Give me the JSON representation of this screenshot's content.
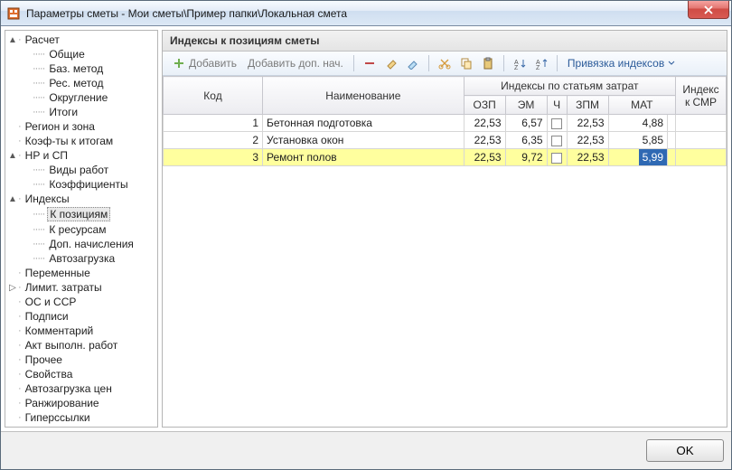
{
  "window": {
    "title": "Параметры сметы - Мои сметы\\Пример папки\\Локальная смета"
  },
  "tree": [
    {
      "arrow": "▲",
      "label": "Расчет"
    },
    {
      "indent": 1,
      "label": "Общие"
    },
    {
      "indent": 1,
      "label": "Баз. метод"
    },
    {
      "indent": 1,
      "label": "Рес. метод"
    },
    {
      "indent": 1,
      "label": "Округление"
    },
    {
      "indent": 1,
      "label": "Итоги"
    },
    {
      "arrow": "",
      "label": "Регион и зона"
    },
    {
      "arrow": "",
      "label": "Коэф-ты к итогам"
    },
    {
      "arrow": "▲",
      "label": "НР и СП"
    },
    {
      "indent": 1,
      "label": "Виды работ"
    },
    {
      "indent": 1,
      "label": "Коэффициенты"
    },
    {
      "arrow": "▲",
      "label": "Индексы"
    },
    {
      "indent": 1,
      "label": "К позициям",
      "selected": true
    },
    {
      "indent": 1,
      "label": "К ресурсам"
    },
    {
      "indent": 1,
      "label": "Доп. начисления"
    },
    {
      "indent": 1,
      "label": "Автозагрузка"
    },
    {
      "arrow": "",
      "label": "Переменные"
    },
    {
      "arrow": "▷",
      "label": "Лимит. затраты"
    },
    {
      "arrow": "",
      "label": "ОС и ССР"
    },
    {
      "arrow": "",
      "label": "Подписи"
    },
    {
      "arrow": "",
      "label": "Комментарий"
    },
    {
      "arrow": "",
      "label": "Акт выполн. работ"
    },
    {
      "arrow": "",
      "label": "Прочее"
    },
    {
      "arrow": "",
      "label": "Свойства"
    },
    {
      "arrow": "",
      "label": "Автозагрузка цен"
    },
    {
      "arrow": "",
      "label": "Ранжирование"
    },
    {
      "arrow": "",
      "label": "Гиперссылки"
    }
  ],
  "main": {
    "title": "Индексы к позициям сметы"
  },
  "toolbar": {
    "add": "Добавить",
    "add_extra": "Добавить доп. нач.",
    "bind": "Привязка индексов"
  },
  "grid": {
    "headers": {
      "code": "Код",
      "name": "Наименование",
      "group": "Индексы по статьям затрат",
      "ozp": "ОЗП",
      "em": "ЭМ",
      "ch": "Ч",
      "zpm": "ЗПМ",
      "mat": "МАТ",
      "smr": "Индекс к СМР"
    },
    "rows": [
      {
        "code": "1",
        "name": "Бетонная подготовка",
        "ozp": "22,53",
        "em": "6,57",
        "zpm": "22,53",
        "mat": "4,88"
      },
      {
        "code": "2",
        "name": "Установка окон",
        "ozp": "22,53",
        "em": "6,35",
        "zpm": "22,53",
        "mat": "5,85"
      },
      {
        "code": "3",
        "name": "Ремонт полов",
        "ozp": "22,53",
        "em": "9,72",
        "zpm": "22,53",
        "mat": "5,99",
        "selected": true,
        "edit": "mat"
      }
    ]
  },
  "footer": {
    "ok": "OK"
  }
}
